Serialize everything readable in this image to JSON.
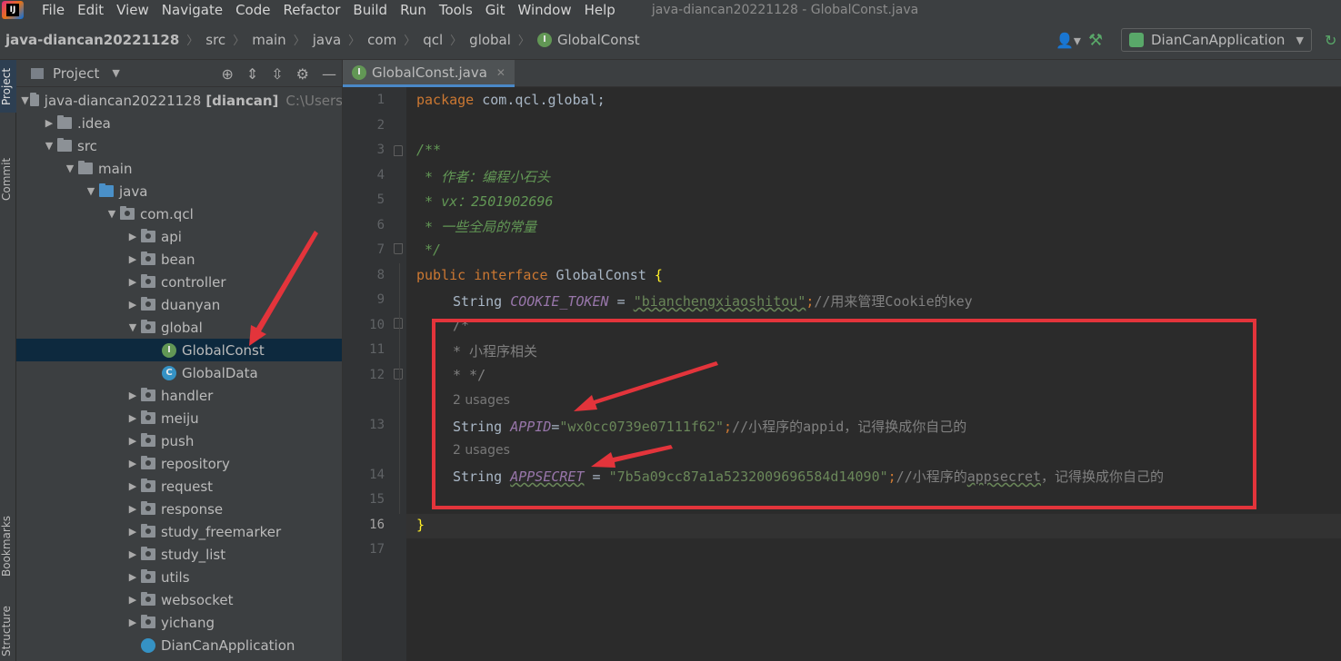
{
  "menubar": {
    "items": [
      "File",
      "Edit",
      "View",
      "Navigate",
      "Code",
      "Refactor",
      "Build",
      "Run",
      "Tools",
      "Git",
      "Window",
      "Help"
    ],
    "window_title": "java-diancan20221128 - GlobalConst.java"
  },
  "breadcrumb": [
    "java-diancan20221128",
    "src",
    "main",
    "java",
    "com",
    "qcl",
    "global",
    "GlobalConst"
  ],
  "run_config": {
    "label": "DianCanApplication"
  },
  "tool_strip": {
    "project": "Project",
    "commit": "Commit",
    "bookmarks": "Bookmarks",
    "structure": "Structure"
  },
  "project_panel": {
    "title": "Project",
    "root_name": "java-diancan20221128",
    "root_module": "[diancan]",
    "root_path": "C:\\Users",
    "tree": [
      {
        "label": ".idea",
        "depth": 1,
        "arrow": "right",
        "icon": "folder"
      },
      {
        "label": "src",
        "depth": 1,
        "arrow": "down",
        "icon": "folder"
      },
      {
        "label": "main",
        "depth": 2,
        "arrow": "down",
        "icon": "folder"
      },
      {
        "label": "java",
        "depth": 3,
        "arrow": "down",
        "icon": "folder-blue"
      },
      {
        "label": "com.qcl",
        "depth": 4,
        "arrow": "down",
        "icon": "package"
      },
      {
        "label": "api",
        "depth": 5,
        "arrow": "right",
        "icon": "package"
      },
      {
        "label": "bean",
        "depth": 5,
        "arrow": "right",
        "icon": "package"
      },
      {
        "label": "controller",
        "depth": 5,
        "arrow": "right",
        "icon": "package"
      },
      {
        "label": "duanyan",
        "depth": 5,
        "arrow": "right",
        "icon": "package"
      },
      {
        "label": "global",
        "depth": 5,
        "arrow": "down",
        "icon": "package"
      },
      {
        "label": "GlobalConst",
        "depth": 6,
        "arrow": "",
        "icon": "interface",
        "selected": true
      },
      {
        "label": "GlobalData",
        "depth": 6,
        "arrow": "",
        "icon": "class"
      },
      {
        "label": "handler",
        "depth": 5,
        "arrow": "right",
        "icon": "package"
      },
      {
        "label": "meiju",
        "depth": 5,
        "arrow": "right",
        "icon": "package"
      },
      {
        "label": "push",
        "depth": 5,
        "arrow": "right",
        "icon": "package"
      },
      {
        "label": "repository",
        "depth": 5,
        "arrow": "right",
        "icon": "package"
      },
      {
        "label": "request",
        "depth": 5,
        "arrow": "right",
        "icon": "package"
      },
      {
        "label": "response",
        "depth": 5,
        "arrow": "right",
        "icon": "package"
      },
      {
        "label": "study_freemarker",
        "depth": 5,
        "arrow": "right",
        "icon": "package"
      },
      {
        "label": "study_list",
        "depth": 5,
        "arrow": "right",
        "icon": "package"
      },
      {
        "label": "utils",
        "depth": 5,
        "arrow": "right",
        "icon": "package"
      },
      {
        "label": "websocket",
        "depth": 5,
        "arrow": "right",
        "icon": "package"
      },
      {
        "label": "yichang",
        "depth": 5,
        "arrow": "right",
        "icon": "package"
      },
      {
        "label": "DianCanApplication",
        "depth": 5,
        "arrow": "",
        "icon": "app"
      }
    ]
  },
  "editor": {
    "tab_label": "GlobalConst.java",
    "line_numbers": [
      "1",
      "2",
      "3",
      "4",
      "5",
      "6",
      "7",
      "8",
      "9",
      "10",
      "11",
      "12",
      "13",
      "14",
      "15",
      "16",
      "17"
    ],
    "current_line": "16",
    "code": {
      "l1_kw": "package",
      "l1_rest": " com.qcl.global;",
      "l3": "/**",
      "l4": " * 作者：编程小石头",
      "l5": " * vx：2501902696",
      "l6": " * 一些全局的常量",
      "l7": " */",
      "l8_kw1": "public",
      "l8_kw2": "interface",
      "l8_name": "GlobalConst",
      "l8_brace": "{",
      "l9_type": "String",
      "l9_field": "COOKIE_TOKEN",
      "l9_eq": " = ",
      "l9_str": "\"bianchengxiaoshitou\"",
      "l9_semi": ";",
      "l9_comment": "//用来管理Cookie的key",
      "l10": "/*",
      "l11": "* 小程序相关",
      "l12": "* */",
      "usages_1": "2 usages",
      "l13_type": "String",
      "l13_field": "APPID",
      "l13_eq": "=",
      "l13_str": "\"wx0cc0739e07111f62\"",
      "l13_semi": ";",
      "l13_comment": "//小程序的appid，记得换成你自己的",
      "usages_2": "2 usages",
      "l14_type": "String",
      "l14_field": "APPSECRET",
      "l14_eq": " = ",
      "l14_str": "\"7b5a09cc87a1a5232009696584d14090\"",
      "l14_semi": ";",
      "l14_comment_a": "//小程序的",
      "l14_comment_b": "appsecret",
      "l14_comment_c": "，记得换成你自己的",
      "l16": "}"
    }
  },
  "colors": {
    "annotation_red": "#e3343b",
    "keyword": "#cc7832",
    "doc_comment": "#629755",
    "string": "#6a8759",
    "field": "#9876aa"
  }
}
